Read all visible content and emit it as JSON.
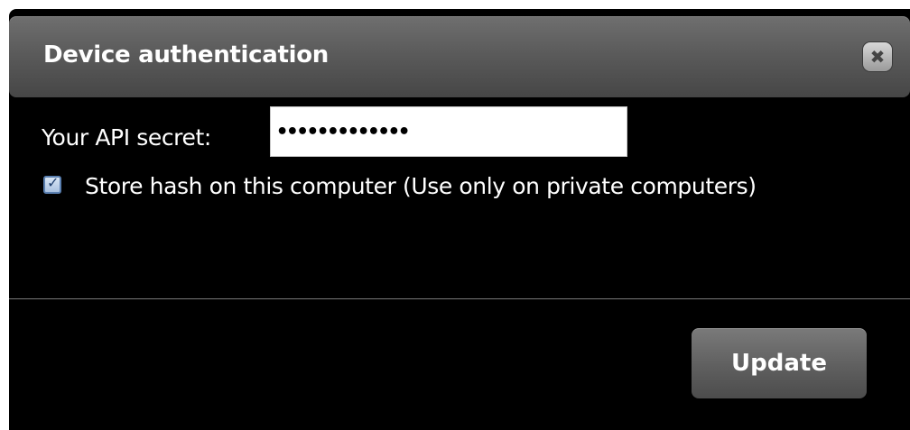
{
  "dialog": {
    "title": "Device authentication",
    "close_icon_glyph": "✖"
  },
  "form": {
    "secret_label": "Your API secret:",
    "secret_value": "•••••••••••••",
    "store_hash_checked": true,
    "store_hash_label": "Store hash on this computer (Use only on private computers)"
  },
  "footer": {
    "update_label": "Update"
  },
  "colors": {
    "background": "#000000",
    "titlebar": "#5b5b5b",
    "text": "#ffffff",
    "button": "#5f5f5f"
  }
}
